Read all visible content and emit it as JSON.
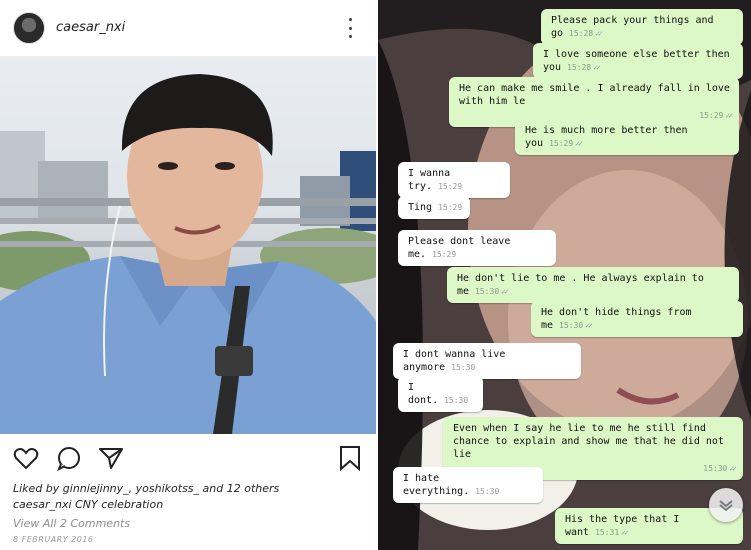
{
  "instagram": {
    "username": "caesar_nxi",
    "likes_text": "Liked by ginniejinny_, yoshikotss_ and 12 others",
    "caption_user": "caesar_nxi",
    "caption_text": "CNY celebration",
    "view_all": "View All 2 Comments",
    "date": "8 FEBRUARY 2016"
  },
  "chat": {
    "messages": [
      {
        "dir": "out",
        "text": "Please pack your things and go",
        "time": "15:28"
      },
      {
        "dir": "out",
        "text": "I love someone else better then you",
        "time": "15:28"
      },
      {
        "dir": "out",
        "text": "He can make me smile . I already fall in love with him le",
        "time": "15:29"
      },
      {
        "dir": "out",
        "text": "He is much more better then you",
        "time": "15:29"
      },
      {
        "dir": "in",
        "text": "I wanna try.",
        "time": "15:29"
      },
      {
        "dir": "in",
        "text": "Ting",
        "time": "15:29"
      },
      {
        "dir": "in",
        "text": "Please dont leave me.",
        "time": "15:29"
      },
      {
        "dir": "out",
        "text": "He don't lie to me . He always explain to me",
        "time": "15:30"
      },
      {
        "dir": "out",
        "text": "He don't hide things from me",
        "time": "15:30"
      },
      {
        "dir": "in",
        "text": "I dont wanna live anymore",
        "time": "15:30"
      },
      {
        "dir": "in",
        "text": "I dont.",
        "time": "15:30"
      },
      {
        "dir": "out",
        "text": "Even when I say he lie to me he still find chance to explain and show me that he did not lie",
        "time": "15:30"
      },
      {
        "dir": "in",
        "text": "I hate everything.",
        "time": "15:30"
      },
      {
        "dir": "out",
        "text": "His the type that I want",
        "time": "15:31"
      }
    ]
  }
}
